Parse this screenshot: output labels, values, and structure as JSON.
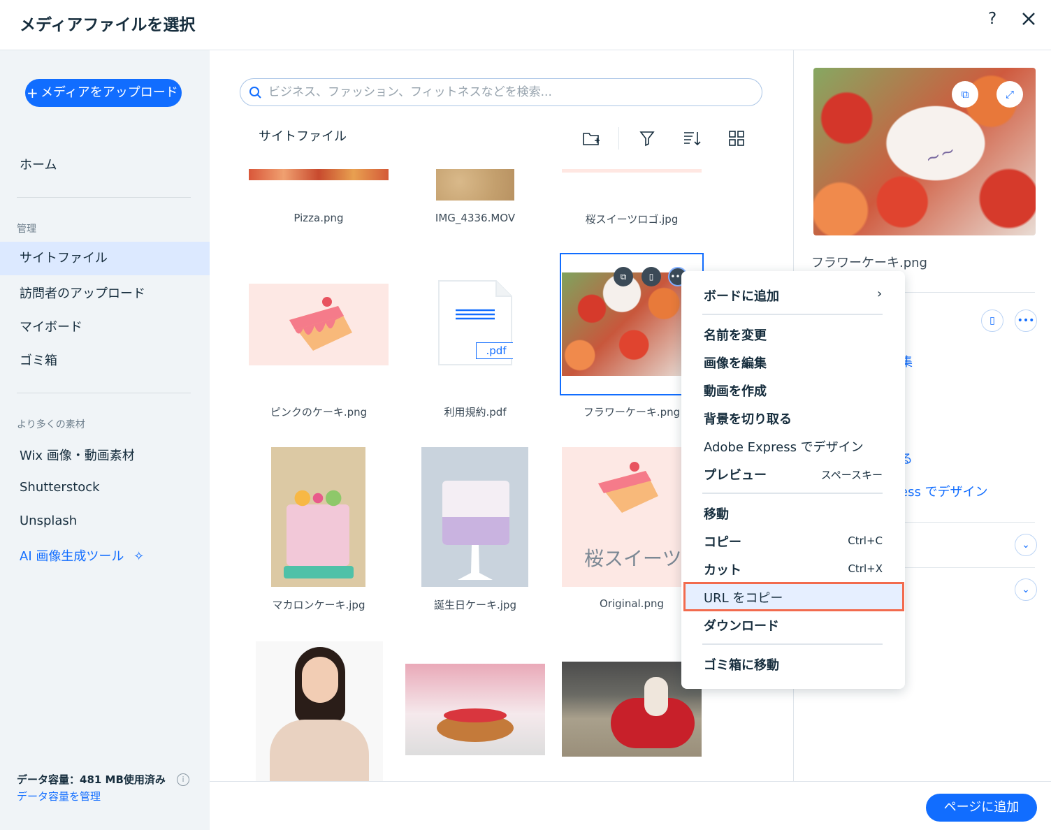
{
  "header": {
    "title": "メディアファイルを選択",
    "help": "?"
  },
  "sidebar": {
    "upload_label": "メディアをアップロード",
    "home": "ホーム",
    "manage_label": "管理",
    "manage_items": [
      "サイトファイル",
      "訪問者のアップロード",
      "マイボード",
      "ゴミ箱"
    ],
    "more_label": "より多くの素材",
    "more_items": [
      "Wix 画像・動画素材",
      "Shutterstock",
      "Unsplash"
    ],
    "ai_tool": "AI 画像生成ツール",
    "storage": "データ容量：481 MB使用済み",
    "storage_link": "データ容量を管理"
  },
  "main": {
    "search_placeholder": "ビジネス、ファッション、フィットネスなどを検索...",
    "section_title": "サイトファイル",
    "files": [
      "Pizza.png",
      "IMG_4336.MOV",
      "桜スイーツロゴ.jpg",
      "ピンクのケーキ.png",
      "利用規約.pdf",
      "フラワーケーキ.png",
      "マカロンケーキ.jpg",
      "誕生日ケーキ.jpg",
      "Original.png"
    ],
    "pdf_badge": ".pdf",
    "logo_text": "桜スイーツ"
  },
  "details": {
    "file_name": "フラワーケーキ.png",
    "link_partial_1": "集",
    "link_partial_2": "る",
    "link_partial_3": "ess でデザイン"
  },
  "context_menu": {
    "add_to_board": "ボードに追加",
    "rename": "名前を変更",
    "edit_image": "画像を編集",
    "create_video": "動画を作成",
    "remove_bg": "背景を切り取る",
    "adobe": "Adobe Express でデザイン",
    "preview": "プレビュー",
    "preview_shortcut": "スペースキー",
    "move": "移動",
    "copy": "コピー",
    "copy_shortcut": "Ctrl+C",
    "cut": "カット",
    "cut_shortcut": "Ctrl+X",
    "copy_url": "URL をコピー",
    "download": "ダウンロード",
    "trash": "ゴミ箱に移動"
  },
  "footer": {
    "add_to_page": "ページに追加"
  },
  "colors": {
    "accent": "#116dff",
    "sidebar_bg": "#f0f4f7",
    "active_bg": "#dce9ff",
    "highlight_border": "#f26b4e"
  }
}
